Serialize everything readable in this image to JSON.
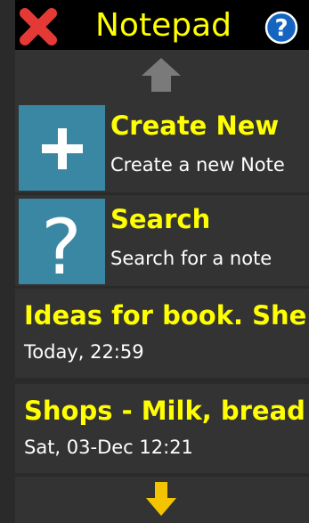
{
  "header": {
    "title": "Notepad",
    "close_icon": "close-icon",
    "help_icon": "help-icon"
  },
  "menu": [
    {
      "title": "Create New",
      "subtitle": "Create a new Note",
      "icon": "plus-icon"
    },
    {
      "title": "Search",
      "subtitle": "Search for a note",
      "icon": "question-mark-icon"
    }
  ],
  "notes": [
    {
      "title": "Ideas for book. She w",
      "date": "Today, 22:59"
    },
    {
      "title": "Shops - Milk, bread a",
      "date": "Sat, 03-Dec 12:21"
    }
  ],
  "colors": {
    "accent_yellow": "#ffff00",
    "tile_blue": "#3a87a4",
    "row_bg": "#333333",
    "page_bg": "#2a2a2a",
    "close_red": "#e53935",
    "help_blue": "#1565c0",
    "arrow_up_gray": "#7a7a7a",
    "arrow_down_yellow": "#f5c400"
  }
}
